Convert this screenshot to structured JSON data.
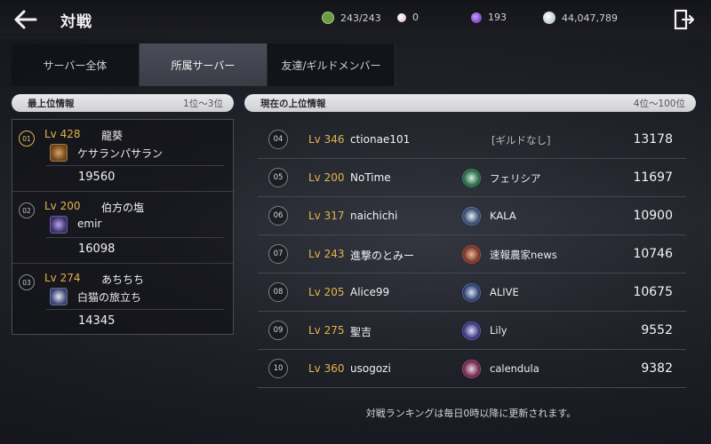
{
  "header": {
    "title": "対戦",
    "resources": [
      {
        "icon": "stamina-icon",
        "value": "243/243",
        "color": "#8fbf5a"
      },
      {
        "icon": "pearl-icon",
        "value": "0",
        "color": "#e8d6d8"
      },
      {
        "icon": "crystal-icon",
        "value": "193",
        "color": "#8a4fd8"
      },
      {
        "icon": "coin-icon",
        "value": "44,047,789",
        "color": "#c8d6e6"
      }
    ]
  },
  "tabs": [
    {
      "label": "サーバー全体",
      "active": false
    },
    {
      "label": "所属サーバー",
      "active": true
    },
    {
      "label": "友達/ギルドメンバー",
      "active": false
    }
  ],
  "top": {
    "header_title": "最上位情報",
    "header_range": "1位〜3位",
    "entries": [
      {
        "rank": "01",
        "level": "Lv 428",
        "name": "龍葵",
        "guild": "ケサランパサラン",
        "score": "19560",
        "guild_color": "#b07a3a"
      },
      {
        "rank": "02",
        "level": "Lv 200",
        "name": "伯方の塩",
        "guild": "emir",
        "score": "16098",
        "guild_color": "#6a5a9a"
      },
      {
        "rank": "03",
        "level": "Lv 274",
        "name": "あちちち",
        "guild": "白猫の旅立ち",
        "score": "14345",
        "guild_color": "#5a6a9a"
      }
    ]
  },
  "current": {
    "header_title": "現在の上位情報",
    "header_range": "4位〜100位",
    "rows": [
      {
        "rank": "04",
        "level": "Lv 346",
        "name": "ctionae101",
        "guild": "[ギルドなし]",
        "has_guild": false,
        "score": "13178"
      },
      {
        "rank": "05",
        "level": "Lv 200",
        "name": "NoTime",
        "guild": "フェリシア",
        "has_guild": true,
        "guild_color": "#3a8a5a",
        "score": "11697"
      },
      {
        "rank": "06",
        "level": "Lv 317",
        "name": "naichichi",
        "guild": "KALA",
        "has_guild": true,
        "guild_color": "#5a7aa8",
        "score": "10900"
      },
      {
        "rank": "07",
        "level": "Lv 243",
        "name": "進撃のとみー",
        "guild": "速報農家news",
        "has_guild": true,
        "guild_color": "#a8503a",
        "score": "10746"
      },
      {
        "rank": "08",
        "level": "Lv 205",
        "name": "Alice99",
        "guild": "ALIVE",
        "has_guild": true,
        "guild_color": "#4a6ab0",
        "score": "10675"
      },
      {
        "rank": "09",
        "level": "Lv 275",
        "name": "聖吉",
        "guild": "Lily",
        "has_guild": true,
        "guild_color": "#5a5ab8",
        "score": "9552"
      },
      {
        "rank": "10",
        "level": "Lv 360",
        "name": "usogozi",
        "guild": "calendula",
        "has_guild": true,
        "guild_color": "#a84a7a",
        "score": "9382"
      }
    ]
  },
  "footer": "対戦ランキングは毎日0時以降に更新されます。"
}
